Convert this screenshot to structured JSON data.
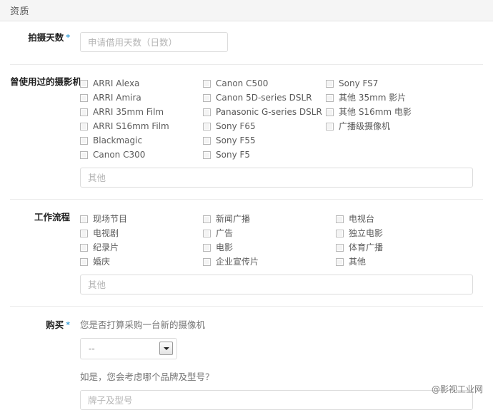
{
  "header": {
    "title": "资质"
  },
  "shoot_days": {
    "label": "拍摄天数",
    "required_mark": "*",
    "placeholder": "申请借用天数（日数）",
    "value": ""
  },
  "cameras": {
    "label": "曾使用过的摄影机",
    "columns": [
      [
        "ARRI Alexa",
        "ARRI Amira",
        "ARRI 35mm Film",
        "ARRI S16mm Film",
        "Blackmagic",
        "Canon C300"
      ],
      [
        "Canon C500",
        "Canon 5D-series DSLR",
        "Panasonic G-series DSLR",
        "Sony F65",
        "Sony F55",
        "Sony F5"
      ],
      [
        "Sony FS7",
        "其他 35mm 影片",
        "其他 S16mm 电影",
        "广播级摄像机"
      ]
    ],
    "other_placeholder": "其他",
    "other_value": ""
  },
  "workflow": {
    "label": "工作流程",
    "columns": [
      [
        "现场节目",
        "电视剧",
        "纪录片",
        "婚庆"
      ],
      [
        "新闻广播",
        "广告",
        "电影",
        "企业宣传片"
      ],
      [
        "电视台",
        "独立电影",
        "体育广播",
        "其他"
      ]
    ],
    "other_placeholder": "其他",
    "other_value": ""
  },
  "purchase": {
    "label": "购买",
    "required_mark": "*",
    "question1": "您是否打算采购一台新的摄像机",
    "select_value": "--",
    "question2": "如是，您会考虑哪个品牌及型号？",
    "model_placeholder": "牌子及型号",
    "model_value": ""
  },
  "watermark": {
    "text": "@影视工业网"
  },
  "colors": {
    "accent": "#3a9fd8",
    "header_bg": "#f5f5f5",
    "border": "#dcdcdc"
  }
}
